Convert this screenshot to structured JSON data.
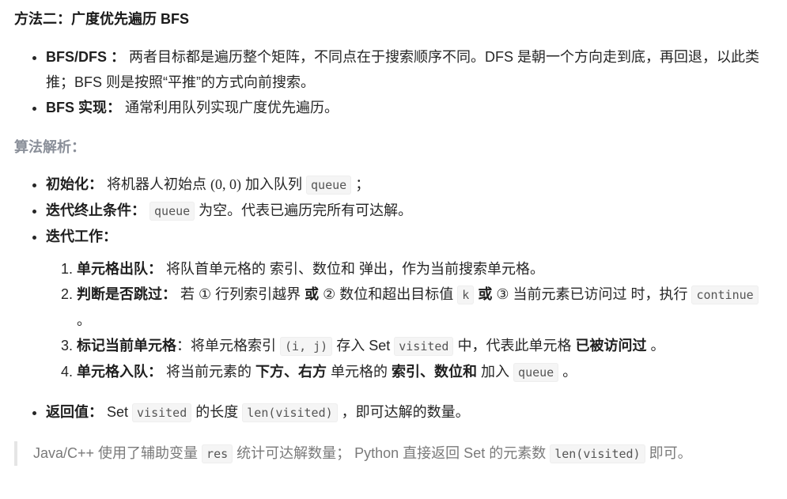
{
  "title": "方法二：广度优先遍历 BFS",
  "intro": [
    {
      "label": "BFS/DFS ：",
      "text": " 两者目标都是遍历整个矩阵，不同点在于搜索顺序不同。DFS 是朝一个方向走到底，再回退，以此类推；BFS 则是按照“平推”的方式向前搜索。"
    },
    {
      "label": "BFS 实现：",
      "text": " 通常利用队列实现广度优先遍历。"
    }
  ],
  "analysis_heading": "算法解析：",
  "init": {
    "label": "初始化：",
    "t1": " 将机器人初始点 ",
    "math": "(0, 0)",
    "t2": " 加入队列 ",
    "code": "queue",
    "t3": " ；"
  },
  "end": {
    "label": "迭代终止条件：",
    "code": "queue",
    "t1": " 为空。代表已遍历完所有可达解。"
  },
  "work": {
    "label": "迭代工作："
  },
  "steps": [
    {
      "label": "单元格出队：",
      "text": " 将队首单元格的 索引、数位和 弹出，作为当前搜索单元格。"
    },
    {
      "label": "判断是否跳过：",
      "t1": " 若 ① 行列索引越界 ",
      "b1": "或",
      "t2": " ② 数位和超出目标值 ",
      "code": "k",
      "b2": "或",
      "t3": " ③ 当前元素已访问过 时，执行 ",
      "code2": "continue",
      "t4": " 。"
    },
    {
      "label": "标记当前单元格",
      "t1": "：将单元格索引 ",
      "code": "(i, j)",
      "t2": " 存入 Set ",
      "code2": "visited",
      "t3": " 中，代表此单元格 ",
      "b1": "已被访问过",
      "t4": " 。"
    },
    {
      "label": "单元格入队：",
      "t1": " 将当前元素的 ",
      "b1": "下方、右方",
      "t2": " 单元格的 ",
      "b2": "索引、数位和",
      "t3": " 加入 ",
      "code": "queue",
      "t4": " 。"
    }
  ],
  "ret": {
    "label": "返回值：",
    "t1": " Set ",
    "code": "visited",
    "t2": " 的长度 ",
    "code2": "len(visited)",
    "t3": " ，即可达解的数量。"
  },
  "note": {
    "t1": "Java/C++ 使用了辅助变量 ",
    "code": "res",
    "t2": " 统计可达解数量； Python 直接返回 Set 的元素数 ",
    "code2": "len(visited)",
    "t3": " 即可。"
  }
}
